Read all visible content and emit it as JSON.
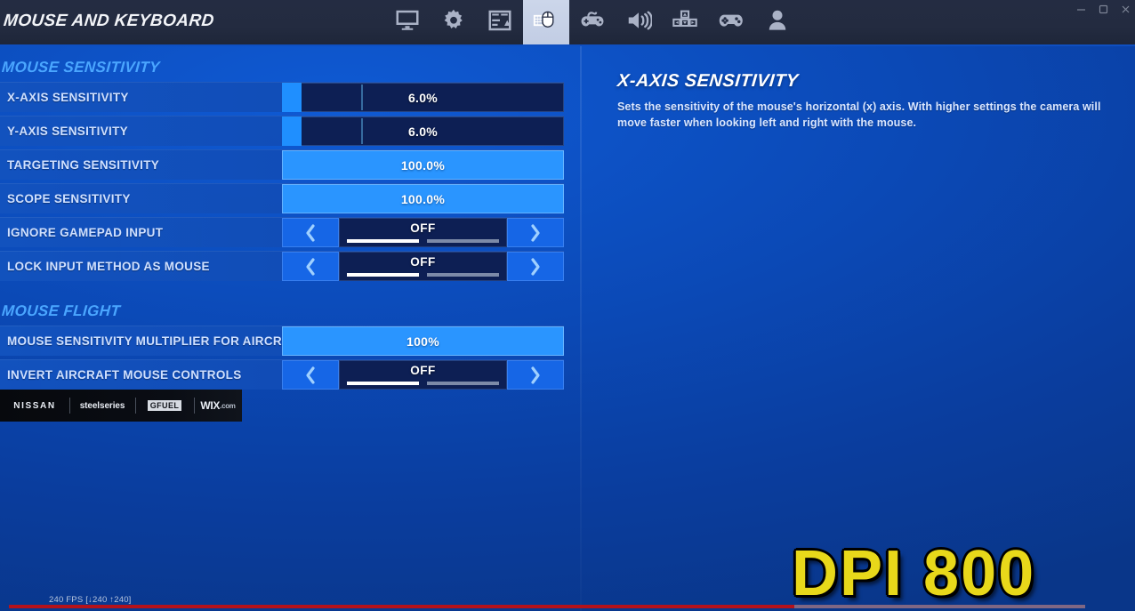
{
  "window": {
    "title": "MOUSE AND KEYBOARD",
    "controls": [
      {
        "name": "minimize",
        "glyph": "minimize-icon"
      },
      {
        "name": "maximize",
        "glyph": "maximize-icon"
      },
      {
        "name": "close",
        "glyph": "close-icon"
      }
    ]
  },
  "tabs": [
    {
      "icon": "monitor-icon",
      "label": "Video",
      "active": false
    },
    {
      "icon": "gear-icon",
      "label": "Game",
      "active": false
    },
    {
      "icon": "hud-icon",
      "label": "Brightness / HUD",
      "active": false
    },
    {
      "icon": "keyboard-mouse-icon",
      "label": "Mouse and Keyboard",
      "active": true
    },
    {
      "icon": "controller-settings-icon",
      "label": "Controller",
      "active": false
    },
    {
      "icon": "audio-icon",
      "label": "Audio",
      "active": false
    },
    {
      "icon": "dpad-icon",
      "label": "Input",
      "active": false
    },
    {
      "icon": "gamepad-icon",
      "label": "Gamepad",
      "active": false
    },
    {
      "icon": "account-icon",
      "label": "Account",
      "active": false
    }
  ],
  "sections": [
    {
      "title": "MOUSE SENSITIVITY",
      "rows": [
        {
          "label": "X-AXIS SENSITIVITY",
          "type": "slider",
          "value": "6.0%",
          "fill_pct": 7,
          "tick_pct": 28
        },
        {
          "label": "Y-AXIS SENSITIVITY",
          "type": "slider",
          "value": "6.0%",
          "fill_pct": 7,
          "tick_pct": 28
        },
        {
          "label": "TARGETING SENSITIVITY",
          "type": "slider_full",
          "value": "100.0%",
          "fill_pct": 100
        },
        {
          "label": "SCOPE SENSITIVITY",
          "type": "slider_full",
          "value": "100.0%",
          "fill_pct": 100
        },
        {
          "label": "IGNORE GAMEPAD INPUT",
          "type": "stepper",
          "value": "OFF",
          "segments": [
            true,
            false
          ]
        },
        {
          "label": "LOCK INPUT METHOD AS MOUSE",
          "type": "stepper",
          "value": "OFF",
          "segments": [
            true,
            false
          ]
        }
      ]
    },
    {
      "title": "MOUSE FLIGHT",
      "rows": [
        {
          "label": "MOUSE SENSITIVITY MULTIPLIER FOR AIRCRAFT",
          "type": "slider_full",
          "value": "100%",
          "fill_pct": 100
        },
        {
          "label": "INVERT AIRCRAFT MOUSE CONTROLS",
          "type": "stepper",
          "value": "OFF",
          "segments": [
            true,
            false
          ]
        }
      ]
    }
  ],
  "description": {
    "title": "X-AXIS SENSITIVITY",
    "body": "Sets the sensitivity of the mouse's horizontal (x) axis. With higher settings the camera will move faster when looking left and right with the mouse."
  },
  "sponsors": [
    {
      "name": "NISSAN"
    },
    {
      "name": "steelseries"
    },
    {
      "name": "GFUEL"
    },
    {
      "name": "WIX",
      "suffix": ".com"
    }
  ],
  "overlay": {
    "fps": "240 FPS [↓240 ↑240]",
    "dpi_text": "DPI 800"
  },
  "colors": {
    "accent_blue": "#1f8fff",
    "panel_blue": "#1252be",
    "dark_slot": "#0d1f54",
    "section_title": "#4aa6ff",
    "dpi_yellow": "#e8d81a",
    "progress_red": "#b4121b"
  }
}
